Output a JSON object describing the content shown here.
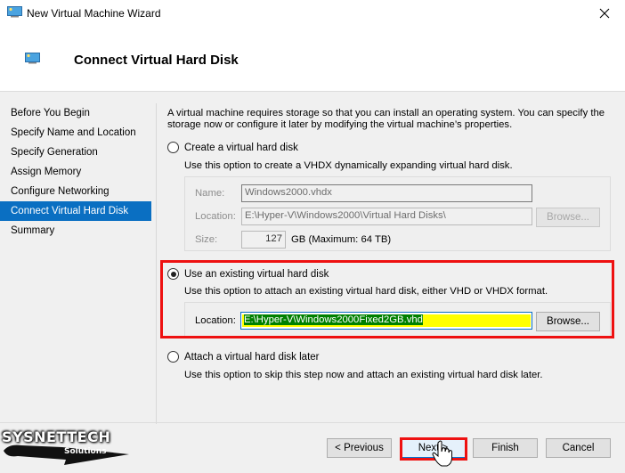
{
  "window": {
    "title": "New Virtual Machine Wizard",
    "close_icon": "close-icon"
  },
  "header": {
    "title": "Connect Virtual Hard Disk",
    "icon": "virtual-machine-icon"
  },
  "nav": {
    "items": [
      {
        "label": "Before You Begin",
        "active": false
      },
      {
        "label": "Specify Name and Location",
        "active": false
      },
      {
        "label": "Specify Generation",
        "active": false
      },
      {
        "label": "Assign Memory",
        "active": false
      },
      {
        "label": "Configure Networking",
        "active": false
      },
      {
        "label": "Connect Virtual Hard Disk",
        "active": true
      },
      {
        "label": "Summary",
        "active": false
      }
    ]
  },
  "content": {
    "intro": "A virtual machine requires storage so that you can install an operating system. You can specify the storage now or configure it later by modifying the virtual machine’s properties.",
    "options": {
      "create": {
        "label": "Create a virtual hard disk",
        "description": "Use this option to create a VHDX dynamically expanding virtual hard disk.",
        "checked": false,
        "name_label": "Name:",
        "name_value": "Windows2000.vhdx",
        "location_label": "Location:",
        "location_value": "E:\\Hyper-V\\Windows2000\\Virtual Hard Disks\\",
        "browse_label": "Browse...",
        "size_label": "Size:",
        "size_value": "127",
        "size_unit": "GB (Maximum: 64 TB)"
      },
      "existing": {
        "label": "Use an existing virtual hard disk",
        "description": "Use this option to attach an existing virtual hard disk, either VHD or VHDX format.",
        "checked": true,
        "location_label": "Location:",
        "location_value": "E:\\Hyper-V\\Windows2000Fixed2GB.vhd",
        "browse_label": "Browse..."
      },
      "later": {
        "label": "Attach a virtual hard disk later",
        "description": "Use this option to skip this step now and attach an existing virtual hard disk later.",
        "checked": false
      }
    }
  },
  "footer": {
    "previous_label": "< Previous",
    "next_label": "Next >",
    "finish_label": "Finish",
    "cancel_label": "Cancel"
  },
  "watermark": {
    "brand": "SYSNETTECH",
    "sub": "Solutions"
  },
  "colors": {
    "accent": "#0a6fc2",
    "highlight_box": "#ee1111",
    "text_highlight": "#ffff00"
  }
}
